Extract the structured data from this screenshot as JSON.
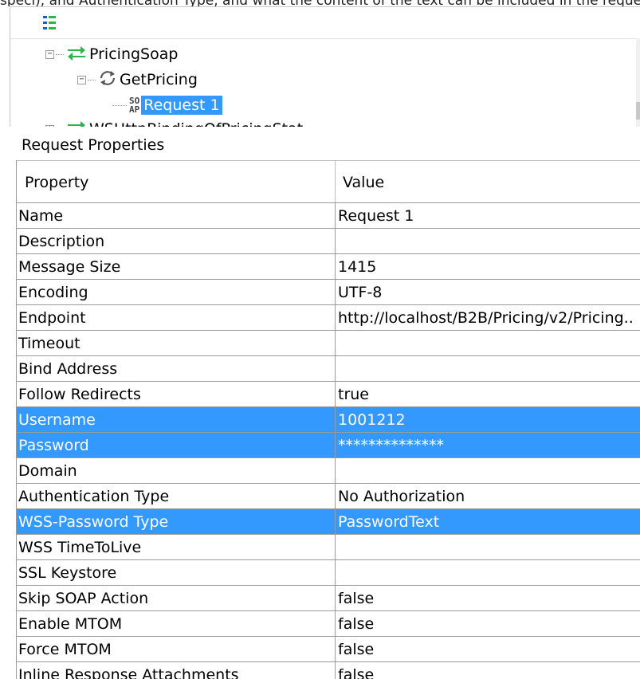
{
  "top_text": "speci), and Authentication Type, and what the content of the text can be included in the request",
  "tree": {
    "toolbar_icon": "properties-icon",
    "nodes": [
      {
        "label": "PricingSoap",
        "icon": "interface-icon",
        "expander": "−"
      },
      {
        "label": "GetPricing",
        "icon": "operation-icon",
        "expander": "−"
      },
      {
        "label": "Request 1",
        "icon": "soap-request-icon",
        "icon_text_top": "SO",
        "icon_text_bottom": "AP",
        "selected": true
      },
      {
        "label": "WSHttpBindingOfPricingStat",
        "icon": "interface-icon",
        "expander": "+"
      }
    ]
  },
  "section_title": "Request Properties",
  "table": {
    "headers": {
      "property": "Property",
      "value": "Value"
    },
    "rows": [
      {
        "property": "Name",
        "value": "Request 1"
      },
      {
        "property": "Description",
        "value": ""
      },
      {
        "property": "Message Size",
        "value": "1415"
      },
      {
        "property": "Encoding",
        "value": "UTF-8"
      },
      {
        "property": "Endpoint",
        "value": "http://localhost/B2B/Pricing/v2/Pricing.."
      },
      {
        "property": "Timeout",
        "value": ""
      },
      {
        "property": "Bind Address",
        "value": ""
      },
      {
        "property": "Follow Redirects",
        "value": "true"
      },
      {
        "property": "Username",
        "value": "1001212",
        "selected": true
      },
      {
        "property": "Password",
        "value": "**************",
        "selected": true
      },
      {
        "property": "Domain",
        "value": ""
      },
      {
        "property": "Authentication Type",
        "value": "No Authorization"
      },
      {
        "property": "WSS-Password Type",
        "value": "PasswordText",
        "selected": true
      },
      {
        "property": "WSS TimeToLive",
        "value": ""
      },
      {
        "property": "SSL Keystore",
        "value": ""
      },
      {
        "property": "Skip SOAP Action",
        "value": "false"
      },
      {
        "property": "Enable MTOM",
        "value": "false"
      },
      {
        "property": "Force MTOM",
        "value": "false"
      },
      {
        "property": "Inline Response Attachments",
        "value": "false"
      }
    ]
  },
  "colors": {
    "selection": "#3399ff",
    "interface_green": "#2bb54a",
    "grid": "#9a9a9a"
  }
}
